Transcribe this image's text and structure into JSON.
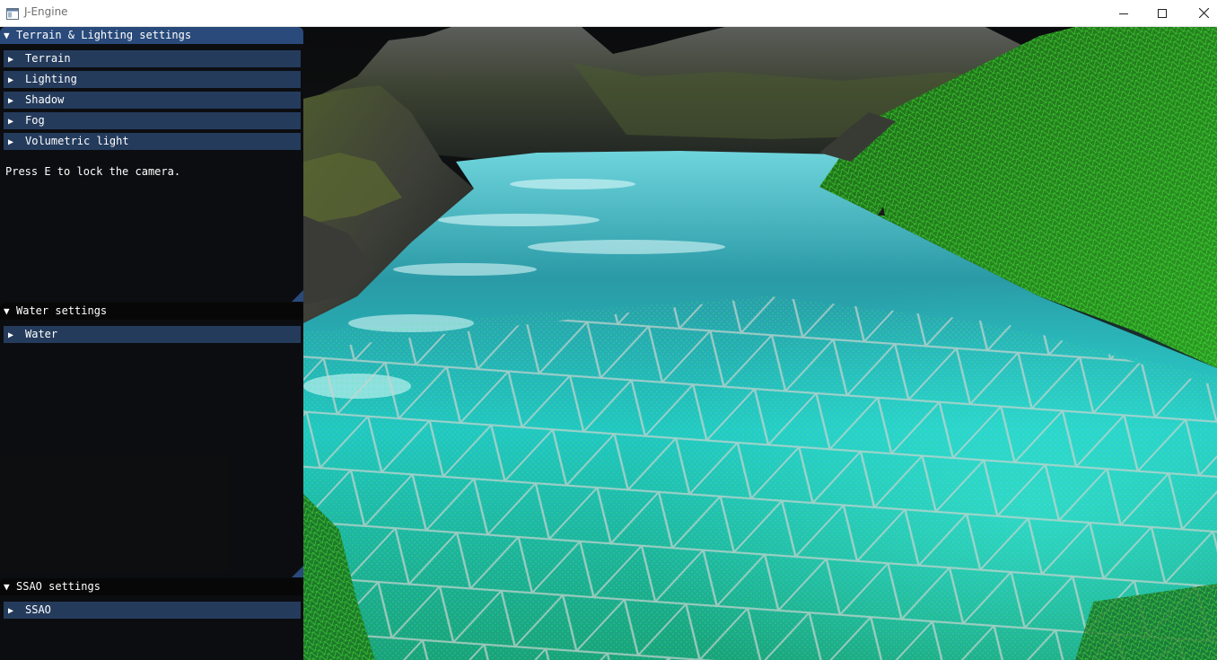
{
  "window": {
    "title": "J-Engine",
    "icon": "app-window-icon",
    "controls": [
      "minimize-icon",
      "maximize-icon",
      "close-icon"
    ]
  },
  "panels": {
    "terrain_lighting": {
      "title": "Terrain & Lighting settings",
      "items": [
        "Terrain",
        "Lighting",
        "Shadow",
        "Fog",
        "Volumetric light"
      ],
      "hint": "Press E to lock the camera."
    },
    "water": {
      "title": "Water settings",
      "items": [
        "Water"
      ]
    },
    "ssao": {
      "title": "SSAO settings",
      "items": [
        "SSAO"
      ]
    }
  },
  "colors": {
    "panel_header_active": "#294a7a",
    "tree_node": "#243b5c",
    "wireframe_terrain": "#38e03a",
    "water": "#2ad9cf"
  }
}
